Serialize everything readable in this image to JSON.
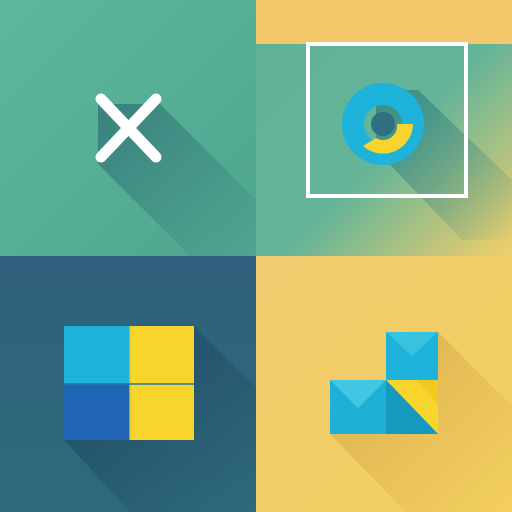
{
  "colors": {
    "teal_bg": "#5BAF97",
    "dark_teal_bg": "#2F6F7E",
    "navy_bg": "#2E5E7A",
    "sand_bg": "#F1CC6C",
    "white": "#FFFFFF",
    "cyan": "#1EB3DA",
    "yellow": "#F7D52C",
    "blue": "#1F64B5",
    "shadow": "#1E5A6A"
  },
  "tiles": [
    {
      "name": "close-x",
      "icon": "close-icon"
    },
    {
      "name": "framed-donut",
      "icon": "donut-chart-icon"
    },
    {
      "name": "grid-four",
      "icon": "grid-icon"
    },
    {
      "name": "stepped-blocks",
      "icon": "blocks-icon"
    }
  ]
}
